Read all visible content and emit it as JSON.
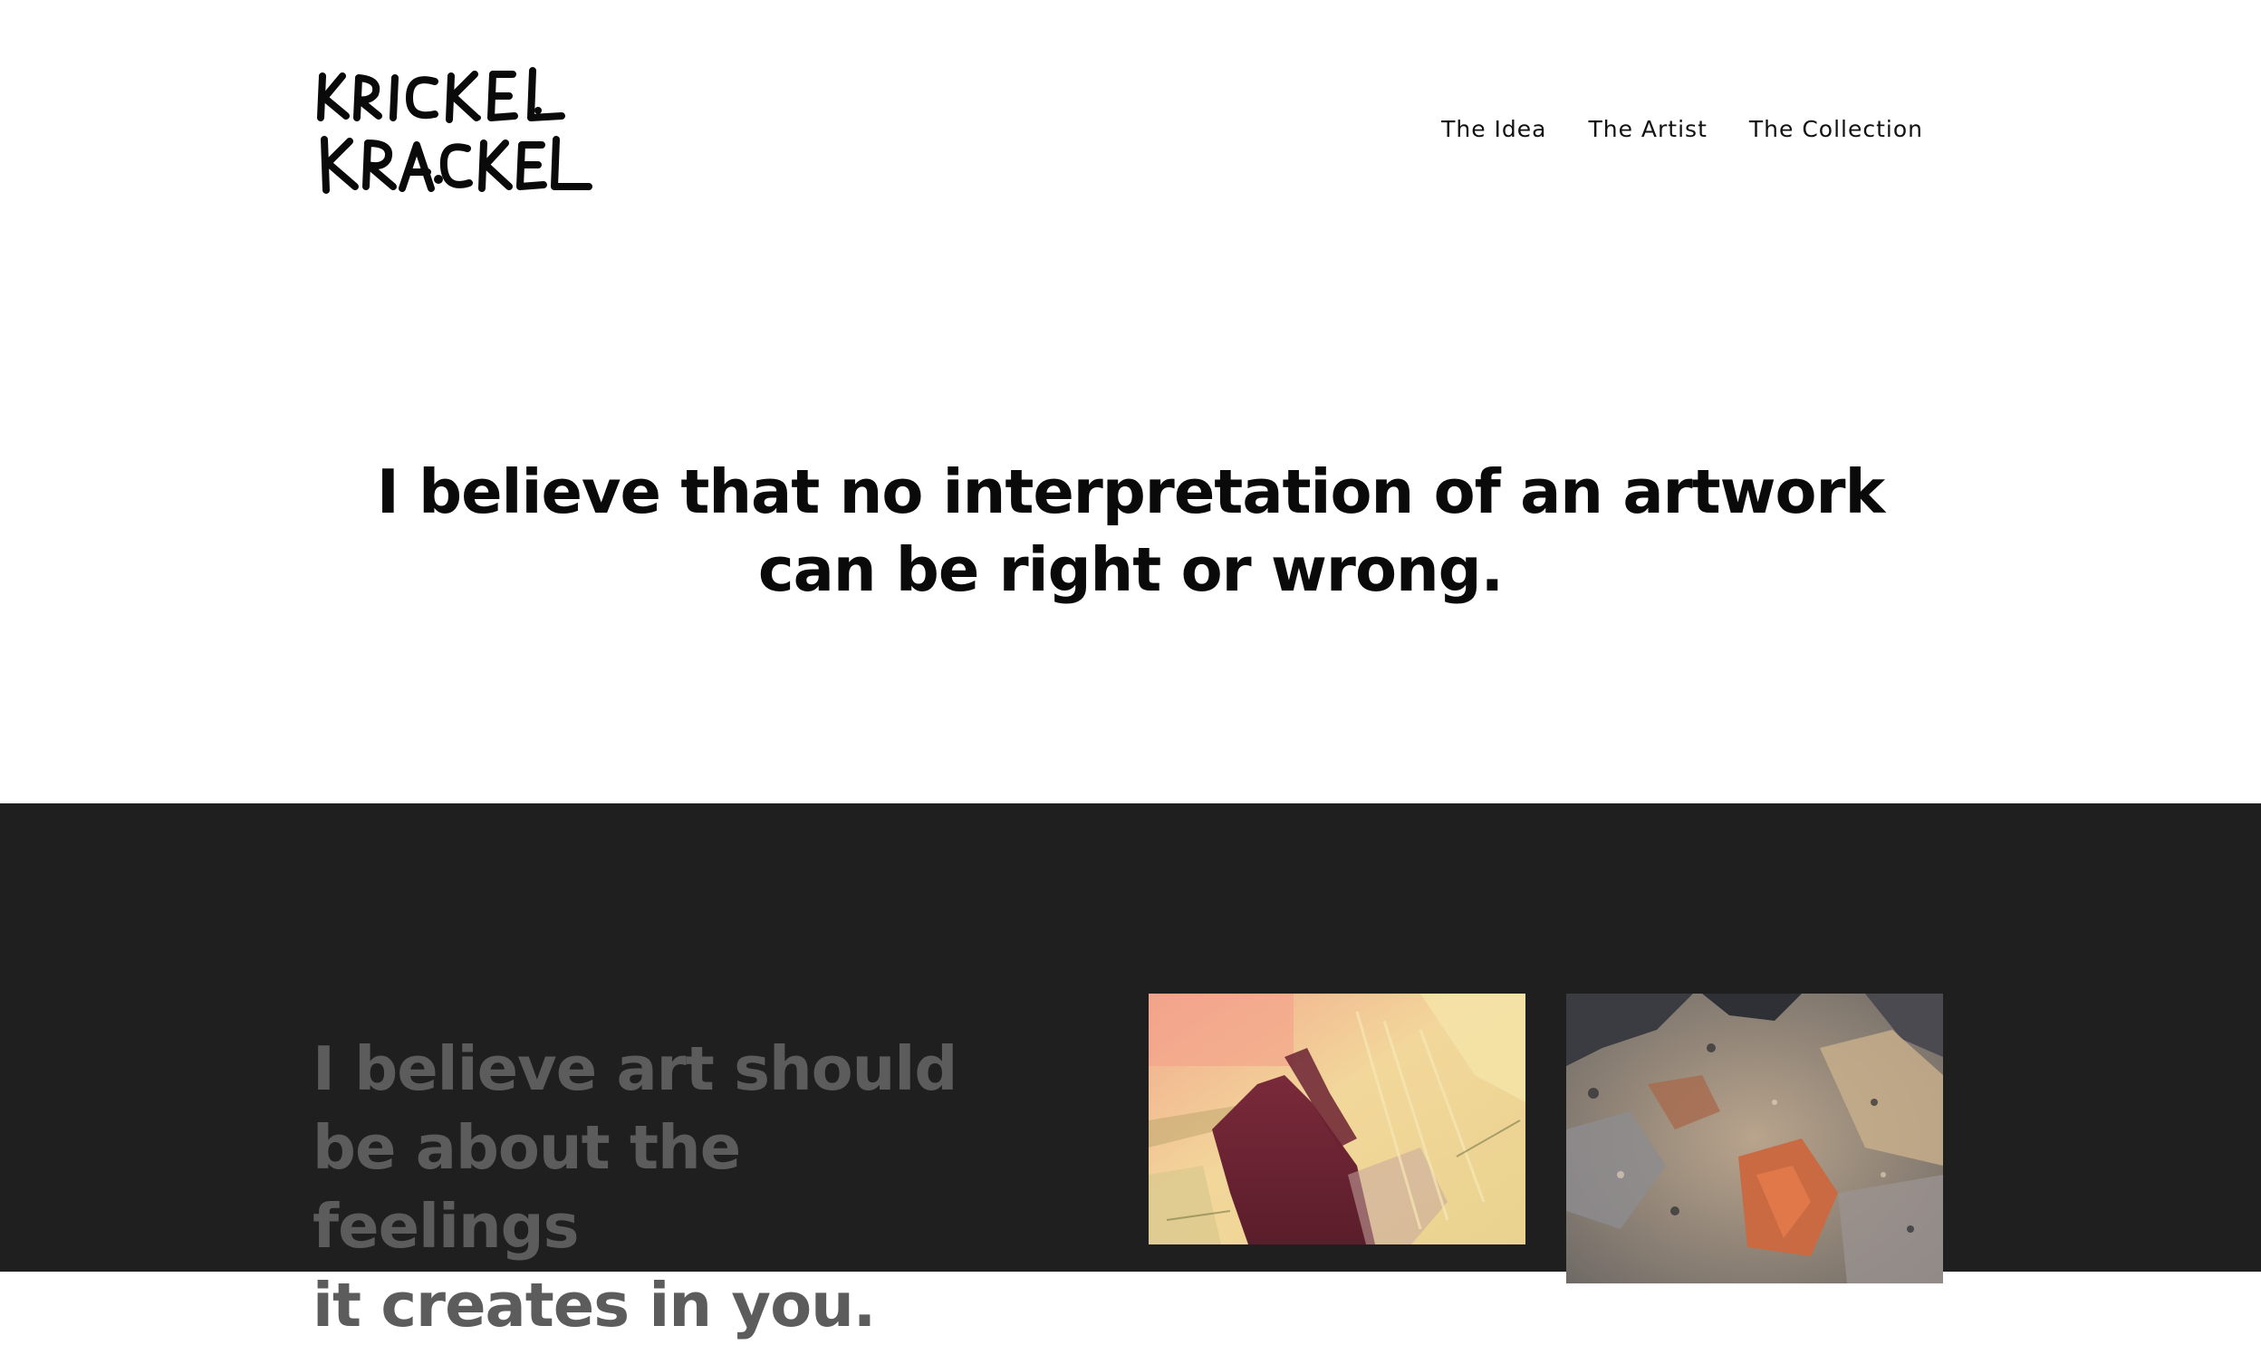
{
  "brand": {
    "name": "Krickel Krackel",
    "logo_line1": "KRICKEL",
    "logo_line2": "KRACKEL"
  },
  "nav": {
    "items": [
      {
        "label": "The Idea"
      },
      {
        "label": "The Artist"
      },
      {
        "label": "The Collection"
      }
    ]
  },
  "hero": {
    "quote_line1": "I believe that no interpretation of an artwork",
    "quote_line2": "can be right or wrong."
  },
  "feature": {
    "line1": "I believe art should",
    "line2": "be about the feelings",
    "line3": "it creates in you."
  },
  "colors": {
    "background": "#ffffff",
    "dark_section": "#1f1f1f",
    "muted_heading": "#5c5c5c",
    "text": "#0a0a0a"
  }
}
